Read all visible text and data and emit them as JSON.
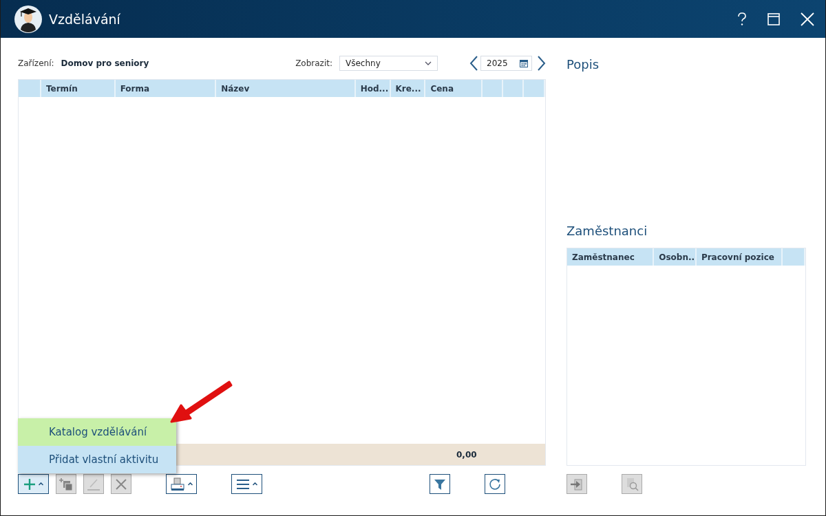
{
  "window": {
    "title": "Vzdělávání"
  },
  "filters": {
    "facility_label": "Zařízení:",
    "facility": "Domov pro seniory",
    "show_label": "Zobrazit:",
    "show": "Všechny",
    "year": "2025"
  },
  "table": {
    "columns": [
      "Termín",
      "Forma",
      "Název",
      "Hod...",
      "Kre...",
      "Cena"
    ],
    "total": "0,00"
  },
  "add_menu": {
    "items": [
      {
        "label": "Katalog vzdělávání",
        "selected": true
      },
      {
        "label": "Přidat vlastní aktivitu",
        "selected": false
      }
    ]
  },
  "toolbar": [
    {
      "kind": "add",
      "disabled": false,
      "dropdown": true,
      "active": true
    },
    {
      "kind": "copy",
      "disabled": true,
      "dropdown": false,
      "active": false
    },
    {
      "kind": "edit",
      "disabled": true,
      "dropdown": false,
      "active": false
    },
    {
      "kind": "delete",
      "disabled": true,
      "dropdown": false,
      "active": false
    },
    {
      "kind": "print",
      "disabled": false,
      "dropdown": true,
      "active": false
    },
    {
      "kind": "menu",
      "disabled": false,
      "dropdown": true,
      "active": false
    },
    {
      "kind": "filter",
      "disabled": false,
      "dropdown": false,
      "active": false
    },
    {
      "kind": "refresh",
      "disabled": false,
      "dropdown": false,
      "active": false
    }
  ],
  "description": {
    "title": "Popis"
  },
  "employees": {
    "title": "Zaměstnanci",
    "columns": [
      "Zaměstnanec",
      "Osobn...",
      "Pracovní pozice"
    ],
    "toolbar": [
      {
        "kind": "assign",
        "disabled": true,
        "dropdown": false,
        "active": false
      },
      {
        "kind": "preview",
        "disabled": true,
        "dropdown": false,
        "active": false
      }
    ]
  }
}
